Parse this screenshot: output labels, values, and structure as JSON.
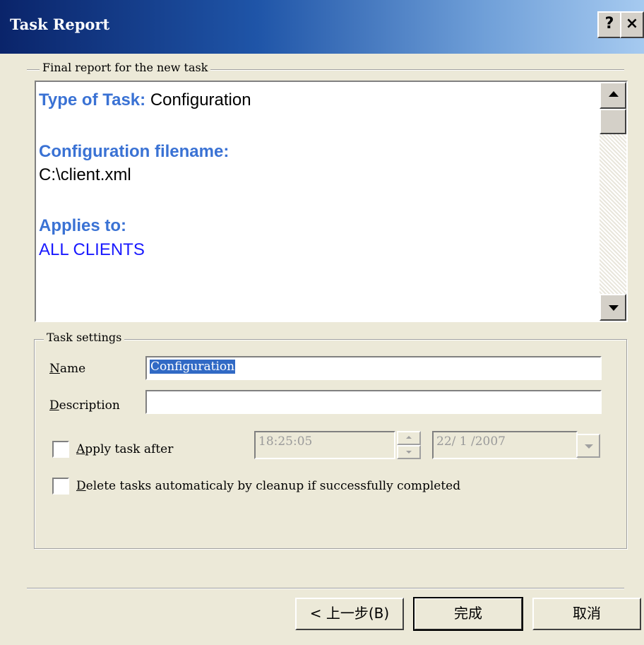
{
  "window": {
    "title": "Task Report",
    "help_label": "?",
    "close_label": "×"
  },
  "report_section": {
    "legend": "Final report for the new task",
    "type_label": "Type of Task:",
    "type_value": "Configuration",
    "filename_label": "Configuration filename:",
    "filename_value": "C:\\client.xml",
    "applies_label": "Applies to:",
    "applies_value": "ALL CLIENTS"
  },
  "task_settings": {
    "legend": "Task settings",
    "name_label_first": "N",
    "name_label_rest": "ame",
    "name_value": "Configuration",
    "description_label_first": "D",
    "description_label_rest": "escription",
    "description_value": "",
    "apply_after_first": "A",
    "apply_after_rest": "pply task after",
    "apply_after_checked": false,
    "time_value": "18:25:05",
    "date_value": "22/ 1 /2007",
    "delete_first": "D",
    "delete_rest": "elete tasks automaticaly by cleanup if successfully completed",
    "delete_checked": false
  },
  "buttons": {
    "back": "< 上一步(B)",
    "finish": "完成",
    "cancel": "取消"
  },
  "colors": {
    "label_blue": "#3a72d4",
    "value_blue": "#1a1aff",
    "selection": "#316ac5"
  }
}
